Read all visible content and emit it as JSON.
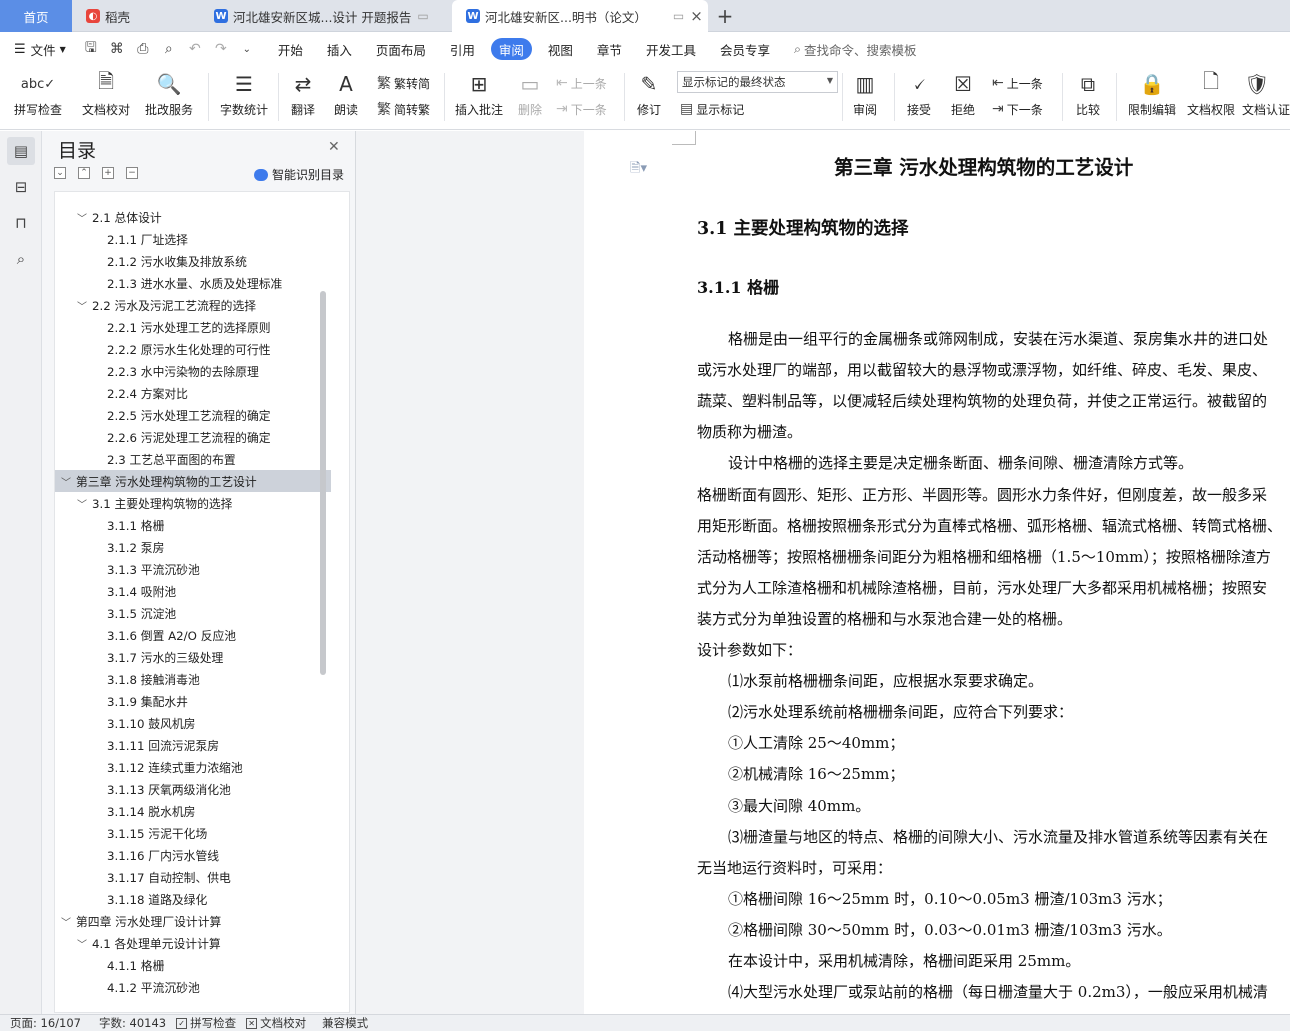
{
  "tabs": {
    "home": "首页",
    "daoke": "稻壳",
    "doc1": "河北雄安新区城...设计 开题报告",
    "doc2": "河北雄安新区...明书（论文）",
    "add": "+",
    "close": "×"
  },
  "menu": {
    "file": "文件",
    "items": [
      "开始",
      "插入",
      "页面布局",
      "引用",
      "审阅",
      "视图",
      "章节",
      "开发工具",
      "会员专享"
    ],
    "search": "查找命令、搜索模板"
  },
  "ribbon": {
    "spell": "拼写检查",
    "proof": "文档校对",
    "batch": "批改服务",
    "wordcount": "字数统计",
    "translate": "翻译",
    "read": "朗读",
    "trad": "繁转简",
    "simp": "简转繁",
    "insert_comment": "插入批注",
    "delete": "删除",
    "prev": "上一条",
    "next": "下一条",
    "revise": "修订",
    "markup_state": "显示标记的最终状态",
    "show_markup": "显示标记",
    "review": "审阅",
    "accept": "接受",
    "reject": "拒绝",
    "prev2": "上一条",
    "next2": "下一条",
    "compare": "比较",
    "restrict": "限制编辑",
    "perm": "文档权限",
    "cert": "文档认证"
  },
  "toc": {
    "title": "目录",
    "smart": "智能识别目录",
    "items": [
      {
        "level": 2,
        "text": "2.1 总体设计",
        "exp": "﹀"
      },
      {
        "level": 3,
        "text": "2.1.1 厂址选择"
      },
      {
        "level": 3,
        "text": "2.1.2 污水收集及排放系统"
      },
      {
        "level": 3,
        "text": "2.1.3 进水水量、水质及处理标准"
      },
      {
        "level": 2,
        "text": "2.2 污水及污泥工艺流程的选择",
        "exp": "﹀"
      },
      {
        "level": 3,
        "text": "2.2.1 污水处理工艺的选择原则"
      },
      {
        "level": 3,
        "text": "2.2.2 原污水生化处理的可行性"
      },
      {
        "level": 3,
        "text": "2.2.3 水中污染物的去除原理"
      },
      {
        "level": 3,
        "text": "2.2.4 方案对比"
      },
      {
        "level": 3,
        "text": "2.2.5 污水处理工艺流程的确定"
      },
      {
        "level": 3,
        "text": "2.2.6 污泥处理工艺流程的确定"
      },
      {
        "level": 3,
        "text": "2.3 工艺总平面图的布置"
      },
      {
        "level": 1,
        "text": "第三章  污水处理构筑物的工艺设计",
        "exp": "﹀",
        "sel": true
      },
      {
        "level": 2,
        "text": "3.1 主要处理构筑物的选择",
        "exp": "﹀"
      },
      {
        "level": 3,
        "text": "3.1.1 格栅"
      },
      {
        "level": 3,
        "text": "3.1.2 泵房"
      },
      {
        "level": 3,
        "text": "3.1.3 平流沉砂池"
      },
      {
        "level": 3,
        "text": "3.1.4 吸附池"
      },
      {
        "level": 3,
        "text": "3.1.5 沉淀池"
      },
      {
        "level": 3,
        "text": "3.1.6 倒置 A2/O 反应池"
      },
      {
        "level": 3,
        "text": "3.1.7 污水的三级处理"
      },
      {
        "level": 3,
        "text": "3.1.8 接触消毒池"
      },
      {
        "level": 3,
        "text": "3.1.9 集配水井"
      },
      {
        "level": 3,
        "text": "3.1.10 鼓风机房"
      },
      {
        "level": 3,
        "text": "3.1.11 回流污泥泵房"
      },
      {
        "level": 3,
        "text": "3.1.12 连续式重力浓缩池"
      },
      {
        "level": 3,
        "text": "3.1.13 厌氧两级消化池"
      },
      {
        "level": 3,
        "text": "3.1.14 脱水机房"
      },
      {
        "level": 3,
        "text": "3.1.15 污泥干化场"
      },
      {
        "level": 3,
        "text": "3.1.16  厂内污水管线"
      },
      {
        "level": 3,
        "text": "3.1.17  自动控制、供电"
      },
      {
        "level": 3,
        "text": "3.1.18  道路及绿化"
      },
      {
        "level": 1,
        "text": "第四章  污水处理厂设计计算",
        "exp": "﹀"
      },
      {
        "level": 2,
        "text": "4.1 各处理单元设计计算",
        "exp": "﹀"
      },
      {
        "level": 3,
        "text": "4.1.1 格栅"
      },
      {
        "level": 3,
        "text": "4.1.2 平流沉砂池"
      }
    ]
  },
  "doc": {
    "chapter": "第三章  污水处理构筑物的工艺设计",
    "h2": "3.1 主要处理构筑物的选择",
    "h3": "3.1.1 格栅",
    "lines": [
      {
        "indent": true,
        "text": "格栅是由一组平行的金属栅条或筛网制成，安装在污水渠道、泵房集水井的进口处"
      },
      {
        "indent": false,
        "text": "或污水处理厂的端部，用以截留较大的悬浮物或漂浮物，如纤维、碎皮、毛发、果皮、"
      },
      {
        "indent": false,
        "text": "蔬菜、塑料制品等，以便减轻后续处理构筑物的处理负荷，并使之正常运行。被截留的"
      },
      {
        "indent": false,
        "text": "物质称为栅渣。"
      },
      {
        "indent": true,
        "text": "设计中格栅的选择主要是决定栅条断面、栅条间隙、栅渣清除方式等。"
      },
      {
        "indent": false,
        "text": "格栅断面有圆形、矩形、正方形、半圆形等。圆形水力条件好，但刚度差，故一般多采"
      },
      {
        "indent": false,
        "text": "用矩形断面。格栅按照栅条形式分为直棒式格栅、弧形格栅、辐流式格栅、转筒式格栅、"
      },
      {
        "indent": false,
        "text": "活动格栅等；按照格栅栅条间距分为粗格栅和细格栅（1.5～10mm）；按照格栅除渣方"
      },
      {
        "indent": false,
        "text": "式分为人工除渣格栅和机械除渣格栅，目前，污水处理厂大多都采用机械格栅；按照安"
      },
      {
        "indent": false,
        "text": "装方式分为单独设置的格栅和与水泵池合建一处的格栅。"
      },
      {
        "indent": false,
        "text": "设计参数如下："
      },
      {
        "indent": true,
        "text": "⑴水泵前格栅栅条间距，应根据水泵要求确定。"
      },
      {
        "indent": true,
        "text": "⑵污水处理系统前格栅栅条间距，应符合下列要求："
      },
      {
        "indent": true,
        "text": "①人工清除    25～40mm；"
      },
      {
        "indent": true,
        "text": "②机械清除    16～25mm；"
      },
      {
        "indent": true,
        "text": "③最大间隙    40mm。"
      },
      {
        "indent": true,
        "text": "⑶栅渣量与地区的特点、格栅的间隙大小、污水流量及排水管道系统等因素有关在"
      },
      {
        "indent": false,
        "text": "无当地运行资料时，可采用："
      },
      {
        "indent": true,
        "text": "①格栅间隙  16～25mm 时，0.10～0.05m3 栅渣/103m3 污水；"
      },
      {
        "indent": true,
        "text": "②格栅间隙 30～50mm 时，0.03～0.01m3 栅渣/103m3 污水。"
      },
      {
        "indent": true,
        "text": "在本设计中，采用机械清除，格栅间距采用 25mm。"
      },
      {
        "indent": true,
        "text": "⑷大型污水处理厂或泵站前的格栅（每日栅渣量大于 0.2m3），一般应采用机械清"
      }
    ]
  },
  "status": {
    "page": "页面: 16/107",
    "words": "字数: 40143",
    "spell": "拼写检查",
    "proof": "文档校对",
    "compat": "兼容模式"
  }
}
